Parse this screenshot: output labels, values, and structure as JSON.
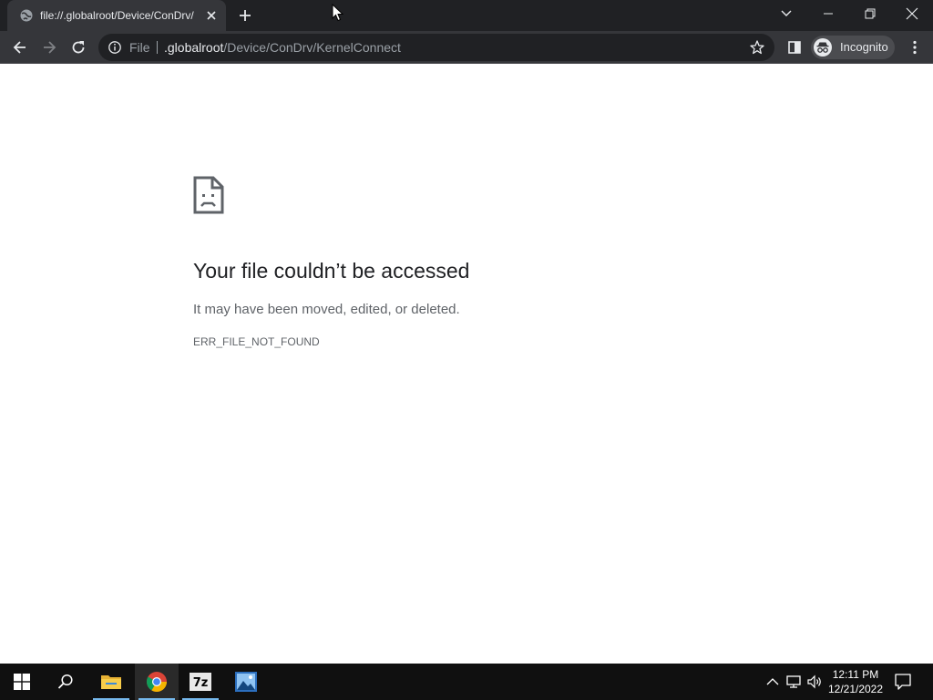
{
  "browser": {
    "tab": {
      "title": "file://.globalroot/Device/ConDrv/"
    },
    "omnibox": {
      "chip_label": "File",
      "url_host": ".globalroot",
      "url_path": "/Device/ConDrv/KernelConnect"
    },
    "profile": {
      "label": "Incognito"
    }
  },
  "error_page": {
    "title": "Your file couldn’t be accessed",
    "description": "It may have been moved, edited, or deleted.",
    "code": "ERR_FILE_NOT_FOUND"
  },
  "taskbar": {
    "apps": [
      {
        "name": "File Explorer"
      },
      {
        "name": "Google Chrome"
      },
      {
        "name": "7-Zip",
        "label": "7z"
      },
      {
        "name": "Photos"
      }
    ],
    "clock": {
      "time": "12:11 PM",
      "date": "12/21/2022"
    }
  },
  "colors": {
    "tabstrip_bg": "#202124",
    "toolbar_bg": "#35363a",
    "page_bg": "#ffffff",
    "taskbar_bg": "#101010",
    "accent": "#76b9ed"
  },
  "icons": {
    "tab": [
      "globe-icon",
      "close-icon",
      "plus-icon"
    ],
    "window": [
      "chevron-down-icon",
      "minimize-icon",
      "restore-icon",
      "close-icon"
    ],
    "toolbar": [
      "back-arrow-icon",
      "forward-arrow-icon",
      "reload-icon",
      "info-icon",
      "star-icon",
      "side-panel-icon",
      "incognito-icon",
      "kebab-menu-icon"
    ],
    "page": [
      "sad-file-icon"
    ],
    "taskbar": [
      "windows-logo-icon",
      "search-icon",
      "folder-icon",
      "chrome-icon",
      "7zip-icon",
      "photos-icon",
      "chevron-up-icon",
      "network-icon",
      "volume-icon",
      "notification-icon"
    ]
  }
}
